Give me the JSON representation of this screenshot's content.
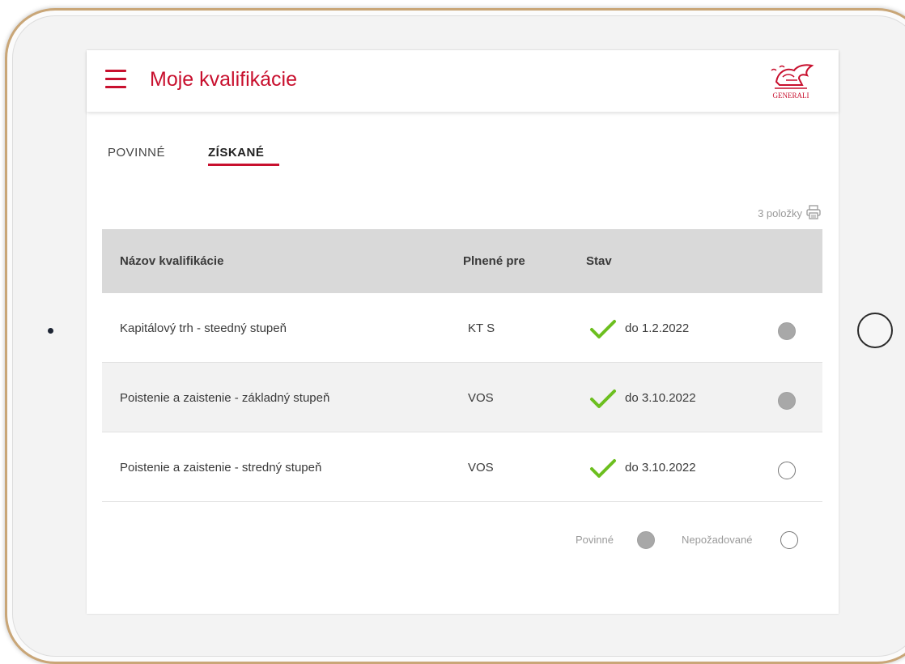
{
  "app": {
    "title": "Moje kvalifikácie",
    "logo_text": "GENERALI",
    "brand_color": "#c8102e"
  },
  "tabs": [
    {
      "label": "POVINNÉ",
      "active": false
    },
    {
      "label": "ZÍSKANÉ",
      "active": true
    }
  ],
  "toolbar": {
    "item_count": "3 položky",
    "icon": "print-icon"
  },
  "table": {
    "headers": [
      "Názov kvalifikácie",
      "Plnené pre",
      "Stav"
    ],
    "rows": [
      {
        "name": "Kapitálový trh - steedný stupeň",
        "fulfilled_for": "KT S",
        "status": "do 1.2.2022",
        "status_icon": "check-icon",
        "required": true
      },
      {
        "name": "Poistenie a zaistenie - základný stupeň",
        "fulfilled_for": "VOS",
        "status": "do 3.10.2022",
        "status_icon": "check-icon",
        "required": true
      },
      {
        "name": "Poistenie a zaistenie - stredný stupeň",
        "fulfilled_for": "VOS",
        "status": "do 3.10.2022",
        "status_icon": "check-icon",
        "required": false
      }
    ]
  },
  "legend": {
    "required_label": "Povinné",
    "not_required_label": "Nepožadované"
  },
  "colors": {
    "check": "#6cbf1f",
    "required_dot": "#a8a8a8",
    "header_bg": "#d9d9d9"
  }
}
